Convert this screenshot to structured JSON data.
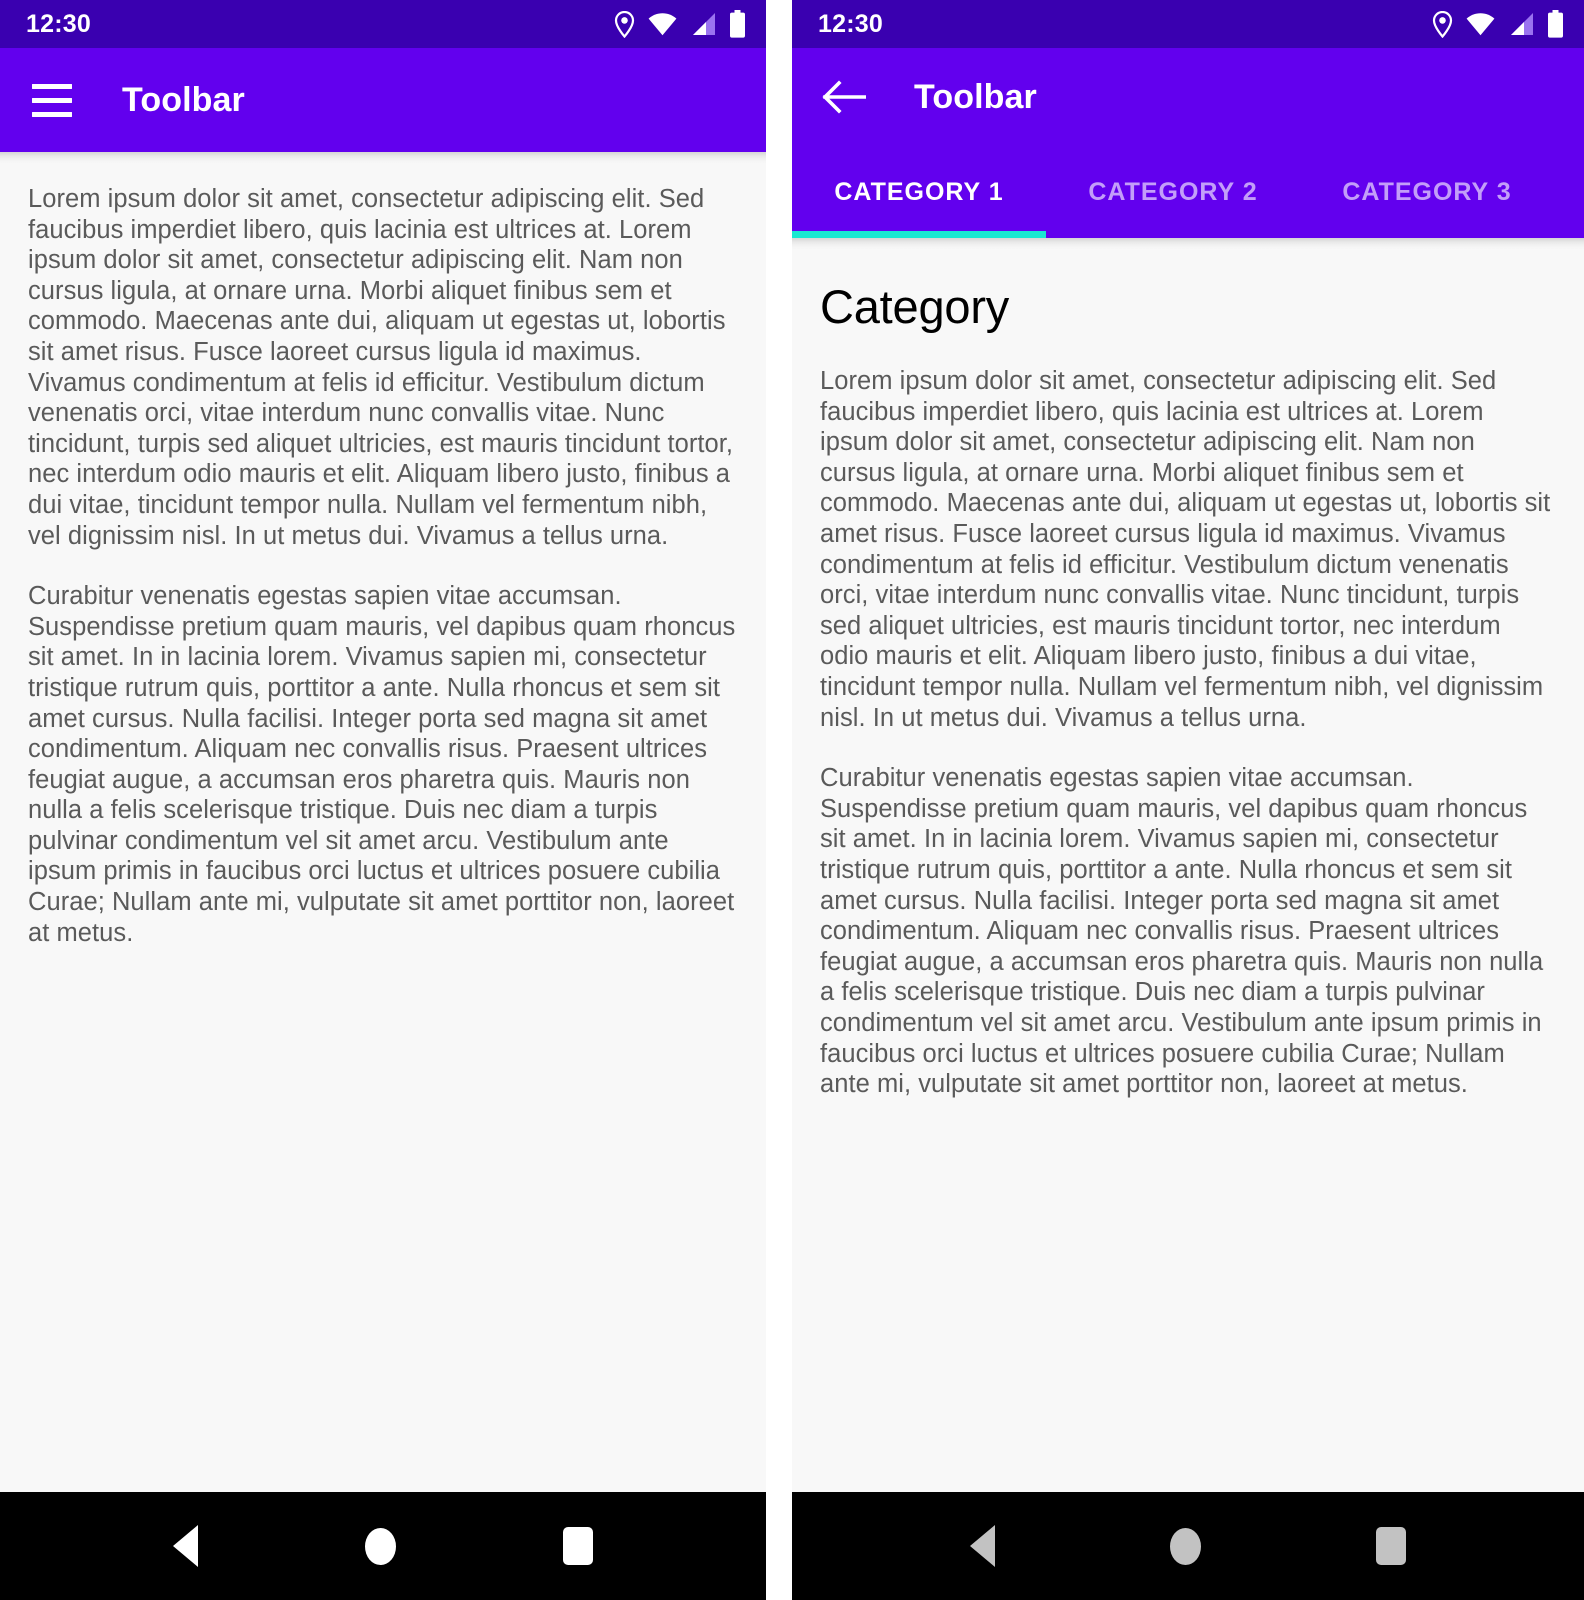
{
  "left_screen": {
    "status_bar": {
      "time": "12:30",
      "icons": [
        "location-pin-icon",
        "wifi-icon",
        "cellular-signal-icon",
        "battery-icon"
      ]
    },
    "toolbar": {
      "nav_icon": "hamburger-menu-icon",
      "title": "Toolbar"
    },
    "body": {
      "paragraph_1": "Lorem ipsum dolor sit amet, consectetur adipiscing elit. Sed faucibus imperdiet libero, quis lacinia est ultrices at. Lorem ipsum dolor sit amet, consectetur adipiscing elit. Nam non cursus ligula, at ornare urna. Morbi aliquet finibus sem et commodo. Maecenas ante dui, aliquam ut egestas ut, lobortis sit amet risus. Fusce laoreet cursus ligula id maximus. Vivamus condimentum at felis id efficitur. Vestibulum dictum venenatis orci, vitae interdum nunc convallis vitae. Nunc tincidunt, turpis sed aliquet ultricies, est mauris tincidunt tortor, nec interdum odio mauris et elit. Aliquam libero justo, finibus a dui vitae, tincidunt tempor nulla. Nullam vel fermentum nibh, vel dignissim nisl. In ut metus dui. Vivamus a tellus urna.",
      "paragraph_2": "Curabitur venenatis egestas sapien vitae accumsan. Suspendisse pretium quam mauris, vel dapibus quam rhoncus sit amet. In in lacinia lorem. Vivamus sapien mi, consectetur tristique rutrum quis, porttitor a ante. Nulla rhoncus et sem sit amet cursus. Nulla facilisi. Integer porta sed magna sit amet condimentum. Aliquam nec convallis risus. Praesent ultrices feugiat augue, a accumsan eros pharetra quis. Mauris non nulla a felis scelerisque tristique. Duis nec diam a turpis pulvinar condimentum vel sit amet arcu. Vestibulum ante ipsum primis in faucibus orci luctus et ultrices posuere cubilia Curae; Nullam ante mi, vulputate sit amet porttitor non, laoreet at metus."
    },
    "system_nav": {
      "back": "back-triangle-icon",
      "home": "home-circle-icon",
      "recents": "recents-square-icon"
    }
  },
  "right_screen": {
    "status_bar": {
      "time": "12:30",
      "icons": [
        "location-pin-icon",
        "wifi-icon",
        "cellular-signal-icon",
        "battery-icon"
      ]
    },
    "toolbar": {
      "nav_icon": "back-arrow-icon",
      "title": "Toolbar"
    },
    "tabs": [
      {
        "label": "CATEGORY 1",
        "active": true
      },
      {
        "label": "CATEGORY 2",
        "active": false
      },
      {
        "label": "CATEGORY 3",
        "active": false
      }
    ],
    "body": {
      "heading": "Category",
      "paragraph_1": "Lorem ipsum dolor sit amet, consectetur adipiscing elit. Sed faucibus imperdiet libero, quis lacinia est ultrices at. Lorem ipsum dolor sit amet, consectetur adipiscing elit. Nam non cursus ligula, at ornare urna. Morbi aliquet finibus sem et commodo. Maecenas ante dui, aliquam ut egestas ut, lobortis sit amet risus. Fusce laoreet cursus ligula id maximus. Vivamus condimentum at felis id efficitur. Vestibulum dictum venenatis orci, vitae interdum nunc convallis vitae. Nunc tincidunt, turpis sed aliquet ultricies, est mauris tincidunt tortor, nec interdum odio mauris et elit. Aliquam libero justo, finibus a dui vitae, tincidunt tempor nulla. Nullam vel fermentum nibh, vel dignissim nisl. In ut metus dui. Vivamus a tellus urna.",
      "paragraph_2": "Curabitur venenatis egestas sapien vitae accumsan. Suspendisse pretium quam mauris, vel dapibus quam rhoncus sit amet. In in lacinia lorem. Vivamus sapien mi, consectetur tristique rutrum quis, porttitor a ante. Nulla rhoncus et sem sit amet cursus. Nulla facilisi. Integer porta sed magna sit amet condimentum. Aliquam nec convallis risus. Praesent ultrices feugiat augue, a accumsan eros pharetra quis. Mauris non nulla a felis scelerisque tristique. Duis nec diam a turpis pulvinar condimentum vel sit amet arcu. Vestibulum ante ipsum primis in faucibus orci luctus et ultrices posuere cubilia Curae; Nullam ante mi, vulputate sit amet porttitor non, laoreet at metus."
    },
    "system_nav": {
      "back": "back-triangle-icon",
      "home": "home-circle-icon",
      "recents": "recents-square-icon"
    }
  },
  "colors": {
    "status_bar_purple": "#3a00b0",
    "toolbar_purple": "#6200ee",
    "tab_indicator_teal": "#19e8d1",
    "content_background": "#f8f8f8",
    "body_text": "#5a5a5a",
    "heading_text": "#000000",
    "nav_bar_background": "#000000"
  }
}
